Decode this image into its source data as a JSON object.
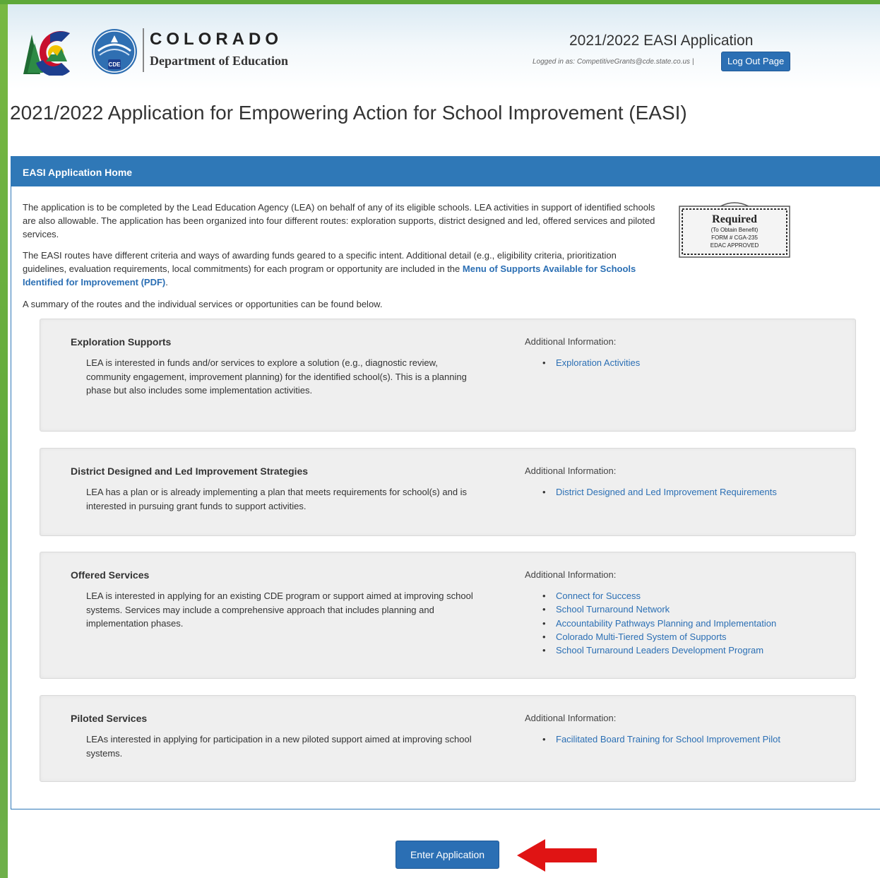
{
  "header": {
    "state_name": "COLORADO",
    "department": "Department of Education",
    "badge_text": "CDE",
    "app_title": "2021/2022 EASI Application",
    "logged_in_text": "Logged in as: CompetitiveGrants@cde.state.co.us |",
    "logout_label": "Log Out Page"
  },
  "page_heading": "2021/2022 Application for Empowering Action for School Improvement (EASI)",
  "panel": {
    "title": "EASI Application Home",
    "intro1": "The application is to be completed by the Lead Education Agency (LEA) on behalf of any of its eligible schools. LEA activities in support of identified schools are also allowable. The application has been organized into four different routes: exploration supports, district designed and led, offered services and piloted services.",
    "intro2_text": "The EASI routes have different criteria and ways of awarding funds geared to a specific intent. Additional detail (e.g., eligibility criteria, prioritization guidelines, evaluation requirements, local commitments) for each program or opportunity are included in the ",
    "intro2_link": "Menu of Supports Available for Schools Identified for Improvement (PDF)",
    "intro2_end": ".",
    "intro3": "A summary of the routes and the individual services or opportunities can be found below.",
    "stamp": {
      "title": "Required",
      "line1": "(To Obtain Benefit)",
      "line2": "FORM # CGA-235",
      "line3": "EDAC APPROVED"
    }
  },
  "routes": [
    {
      "title": "Exploration Supports",
      "description": "LEA is interested in funds and/or services to explore a solution (e.g., diagnostic review, community engagement, improvement planning) for the identified school(s). This is a planning phase but also includes some implementation activities.",
      "addl_label": "Additional Information:",
      "links": [
        "Exploration Activities"
      ]
    },
    {
      "title": "District Designed and Led Improvement Strategies",
      "description": "LEA has a plan or is already implementing a plan that meets requirements for school(s) and is interested in pursuing grant funds to support activities.",
      "addl_label": "Additional Information:",
      "links": [
        "District Designed and Led Improvement Requirements"
      ]
    },
    {
      "title": "Offered Services",
      "description": "LEA is interested in applying for an existing CDE program or support aimed at improving school systems. Services may include a comprehensive approach that includes planning and implementation phases.",
      "addl_label": "Additional Information:",
      "links": [
        "Connect for Success",
        "School Turnaround Network",
        "Accountability Pathways Planning and Implementation",
        "Colorado Multi-Tiered System of Supports",
        "School Turnaround Leaders Development Program"
      ]
    },
    {
      "title": "Piloted Services",
      "description": "LEAs interested in applying for participation in a new piloted support aimed at improving school systems.",
      "addl_label": "Additional Information:",
      "links": [
        "Facilitated Board Training for School Improvement Pilot"
      ]
    }
  ],
  "enter_button": "Enter Application",
  "colors": {
    "primary_blue": "#2b6fb4",
    "panel_blue": "#2f78b7",
    "side_green": "#6fb04a",
    "arrow_red": "#e01414"
  },
  "icons": [
    "colorado-flag-logo",
    "cde-badge-icon",
    "required-stamp-icon",
    "red-arrow-icon"
  ]
}
